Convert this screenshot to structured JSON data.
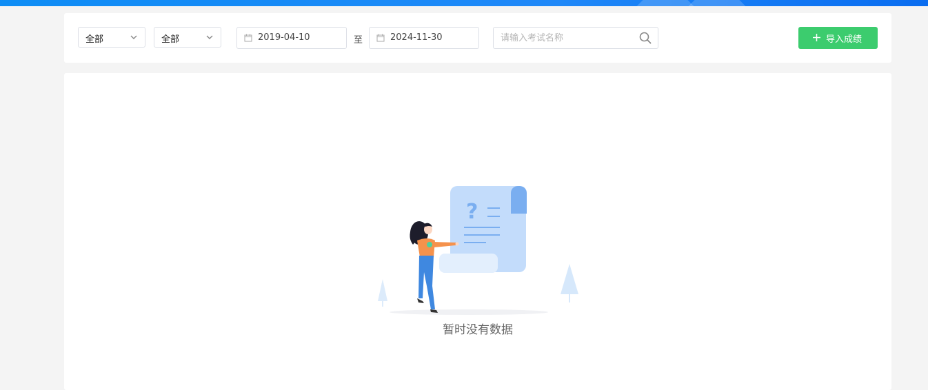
{
  "filters": {
    "select1": {
      "value": "全部",
      "icon": "chevron-down-icon"
    },
    "select2": {
      "value": "全部",
      "icon": "chevron-down-icon"
    },
    "date_start": {
      "value": "2019-04-10",
      "icon": "calendar-icon"
    },
    "date_separator": "至",
    "date_end": {
      "value": "2024-11-30",
      "icon": "calendar-icon"
    },
    "search": {
      "placeholder": "请输入考试名称",
      "value": "",
      "icon": "search-icon"
    },
    "import_button": {
      "label": "导入成绩",
      "icon": "plus-icon"
    }
  },
  "empty_state": {
    "message": "暂时没有数据"
  },
  "colors": {
    "top_bar": "#1f88f8",
    "primary_green": "#3ccc6e",
    "border": "#dcdfe6",
    "background": "#f4f4f4"
  }
}
